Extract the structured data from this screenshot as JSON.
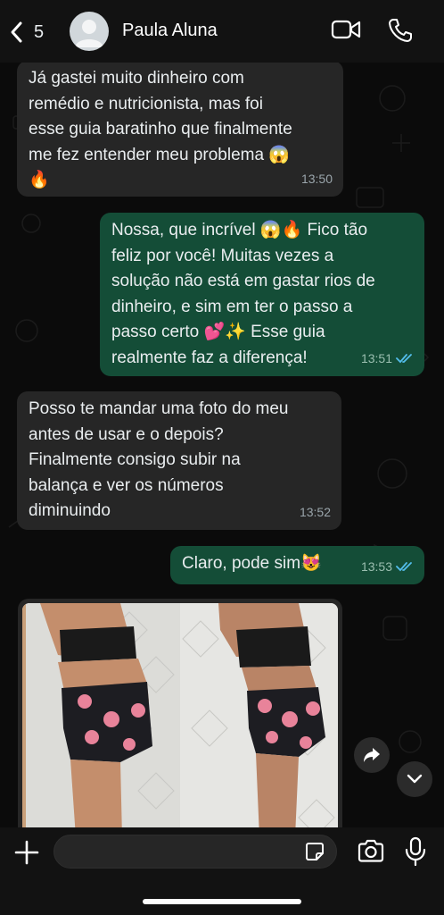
{
  "header": {
    "back_count": "5",
    "contact_name": "Paula Aluna"
  },
  "messages": [
    {
      "direction": "incoming",
      "text": "Já gastei muito dinheiro com\nremédio e nutricionista, mas foi\nesse guia baratinho que finalmente\nme fez entender meu problema 😱\n🔥",
      "time": "13:50"
    },
    {
      "direction": "outgoing",
      "text": "Nossa, que incrível 😱🔥 Fico tão\nfeliz por você! Muitas vezes a\nsolução não está em gastar rios de\ndinheiro, e sim em ter o passo a\npasso certo 💕✨ Esse guia\nrealmente faz a diferença!",
      "time": "13:51",
      "read": true
    },
    {
      "direction": "incoming",
      "text": "Posso te mandar uma foto do meu\nantes de usar e o depois?\nFinalmente consigo subir na\nbalança e ver os números\ndiminuindo",
      "time": "13:52"
    },
    {
      "direction": "outgoing",
      "text": "Claro, pode sim😻",
      "time": "13:53",
      "read": true
    }
  ],
  "photo_message": {
    "description_icon": "before-after-photo"
  },
  "composer": {
    "placeholder": ""
  },
  "colors": {
    "header_bg": "#121212",
    "incoming_bubble": "#262626",
    "outgoing_bubble": "#144d37",
    "read_ticks": "#53bdeb"
  }
}
